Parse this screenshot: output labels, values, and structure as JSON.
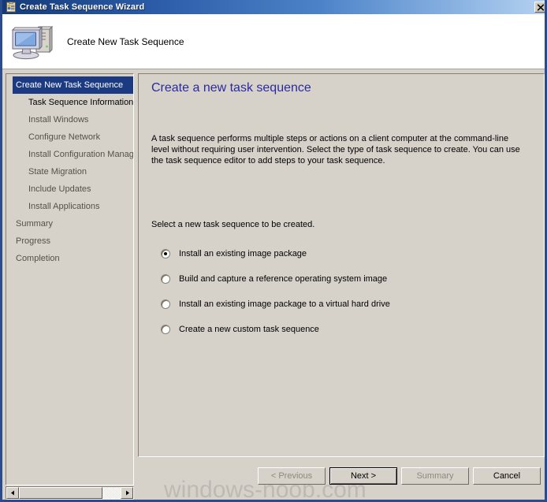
{
  "window": {
    "title": "Create Task Sequence Wizard",
    "title_icon": "task-sequence-clipboard-icon",
    "close_label": "Close",
    "accent_titlebar_dark": "#143a78",
    "accent_titlebar_light": "#b6d2f0",
    "face_color": "#d6d2ca",
    "selection_color": "#1b3a82",
    "heading_color": "#2a2aa0"
  },
  "header": {
    "title": "Create New Task Sequence",
    "icon": "computer-icon"
  },
  "sidebar": {
    "items": [
      {
        "label": "Create New Task Sequence",
        "state": "selected",
        "indent": false
      },
      {
        "label": "Task Sequence Information",
        "state": "next",
        "indent": true
      },
      {
        "label": "Install Windows",
        "state": "disabled",
        "indent": true
      },
      {
        "label": "Configure Network",
        "state": "disabled",
        "indent": true
      },
      {
        "label": "Install Configuration Manag",
        "state": "disabled",
        "indent": true
      },
      {
        "label": "State Migration",
        "state": "disabled",
        "indent": true
      },
      {
        "label": "Include Updates",
        "state": "disabled",
        "indent": true
      },
      {
        "label": "Install Applications",
        "state": "disabled",
        "indent": true
      },
      {
        "label": "Summary",
        "state": "disabled",
        "indent": false
      },
      {
        "label": "Progress",
        "state": "disabled",
        "indent": false
      },
      {
        "label": "Completion",
        "state": "disabled",
        "indent": false
      }
    ],
    "scrollbar": {
      "left_arrow": "◄",
      "right_arrow": "►"
    }
  },
  "content": {
    "heading": "Create a new task sequence",
    "description": "A task sequence performs multiple steps or actions on a client computer at the command-line level without requiring user intervention. Select the type of task sequence to create. You can use the task sequence editor to add steps to your task sequence.",
    "select_label": "Select a new task sequence to be created.",
    "options": [
      {
        "label": "Install an existing image package",
        "checked": true
      },
      {
        "label": "Build and capture a reference operating system image",
        "checked": false
      },
      {
        "label": "Install an existing image package to a virtual hard drive",
        "checked": false
      },
      {
        "label": "Create a new custom task sequence",
        "checked": false
      }
    ]
  },
  "buttons": {
    "previous": "< Previous",
    "next": "Next >",
    "summary": "Summary",
    "cancel": "Cancel"
  },
  "watermark": {
    "text": "windows-noob.com"
  }
}
